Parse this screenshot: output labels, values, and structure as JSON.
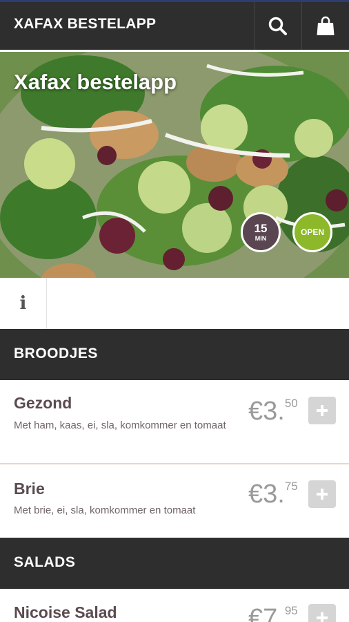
{
  "header": {
    "app_title": "XAFAX BESTELAPP",
    "search_icon": "search-icon",
    "cart_icon": "shopping-bag-icon"
  },
  "hero": {
    "title": "Xafax bestelapp",
    "time_badge": {
      "number": "15",
      "unit": "MIN"
    },
    "status_badge": "OPEN"
  },
  "info": {
    "icon_text": "i"
  },
  "sections": [
    {
      "title": "BROODJES",
      "items": [
        {
          "name": "Gezond",
          "description": "Met ham, kaas, ei, sla, komkommer en tomaat",
          "price_main": "€3.",
          "price_cents": "50"
        },
        {
          "name": "Brie",
          "description": "Met brie, ei, sla, komkommer en tomaat",
          "price_main": "€3.",
          "price_cents": "75"
        }
      ]
    },
    {
      "title": "SALADS",
      "items": [
        {
          "name": "Nicoise Salad",
          "price_main": "€7.",
          "price_cents": "95"
        }
      ]
    }
  ],
  "colors": {
    "header_bg": "#2e2e2e",
    "time_badge": "#5a4650",
    "open_badge": "#8cb82a",
    "item_name": "#5b4b51",
    "price": "#9a9a9a"
  }
}
